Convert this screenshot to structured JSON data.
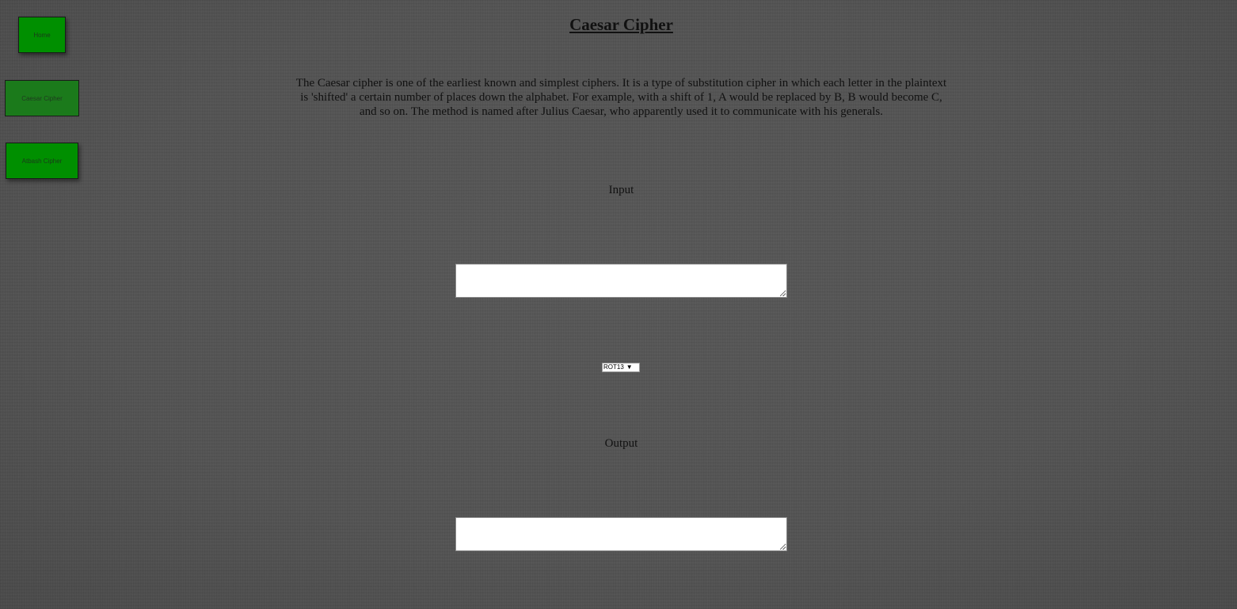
{
  "nav": {
    "home_label": "Home",
    "caesar_label": "Caesar Cipher",
    "atbash_label": "Atbash Cipher"
  },
  "page": {
    "title": "Caesar Cipher",
    "description": "The Caesar cipher is one of the earliest known and simplest ciphers. It is a type of substitution cipher in which each letter in the plaintext is 'shifted' a certain number of places down the alphabet. For example, with a shift of 1, A would be replaced by B, B would become C, and so on. The method is named after Julius Caesar, who apparently used it to communicate with his generals."
  },
  "input": {
    "label": "Input",
    "value": ""
  },
  "shift": {
    "selected": "ROT13",
    "arrow_icon": "triangle-down-icon"
  },
  "output": {
    "label": "Output",
    "value": ""
  },
  "colors": {
    "background": "#555555",
    "nav_button": "#008f00",
    "nav_button_active": "#1b7a1b"
  }
}
